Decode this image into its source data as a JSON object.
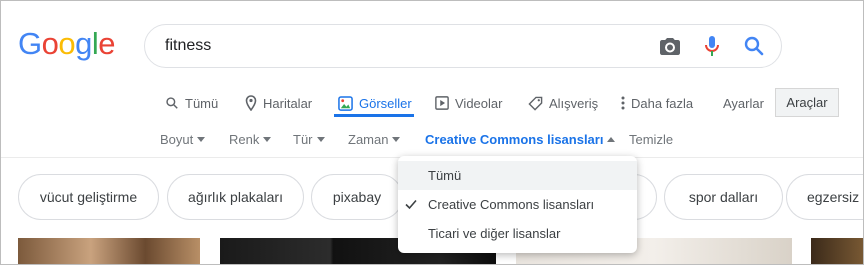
{
  "logo": {
    "letters": [
      "G",
      "o",
      "o",
      "g",
      "l",
      "e"
    ],
    "colors": [
      "#4285F4",
      "#EA4335",
      "#FBBC05",
      "#4285F4",
      "#34A853",
      "#EA4335"
    ]
  },
  "search": {
    "value": "fitness"
  },
  "tabs": [
    {
      "label": "Tümü",
      "icon": "search-icon"
    },
    {
      "label": "Haritalar",
      "icon": "map-pin-icon"
    },
    {
      "label": "Görseller",
      "icon": "image-icon",
      "active": true
    },
    {
      "label": "Videolar",
      "icon": "play-icon"
    },
    {
      "label": "Alışveriş",
      "icon": "tag-icon"
    },
    {
      "label": "Daha fazla",
      "icon": "more-vert-icon"
    },
    {
      "label": "Ayarlar"
    },
    {
      "label": "Araçlar"
    }
  ],
  "filters": [
    {
      "label": "Boyut"
    },
    {
      "label": "Renk"
    },
    {
      "label": "Tür"
    },
    {
      "label": "Zaman"
    },
    {
      "label": "Creative Commons lisansları",
      "active": true
    },
    {
      "label": "Temizle"
    }
  ],
  "chips": [
    "vücut geliştirme",
    "ağırlık plakaları",
    "pixabay",
    "spor dalları",
    "egzersiz"
  ],
  "dropdown": {
    "items": [
      {
        "label": "Tümü",
        "checked": false,
        "highlighted": true
      },
      {
        "label": "Creative Commons lisansları",
        "checked": true
      },
      {
        "label": "Ticari ve diğer lisanslar",
        "checked": false
      }
    ]
  },
  "colors": {
    "accent": "#1a73e8",
    "muted": "#5f6368"
  }
}
